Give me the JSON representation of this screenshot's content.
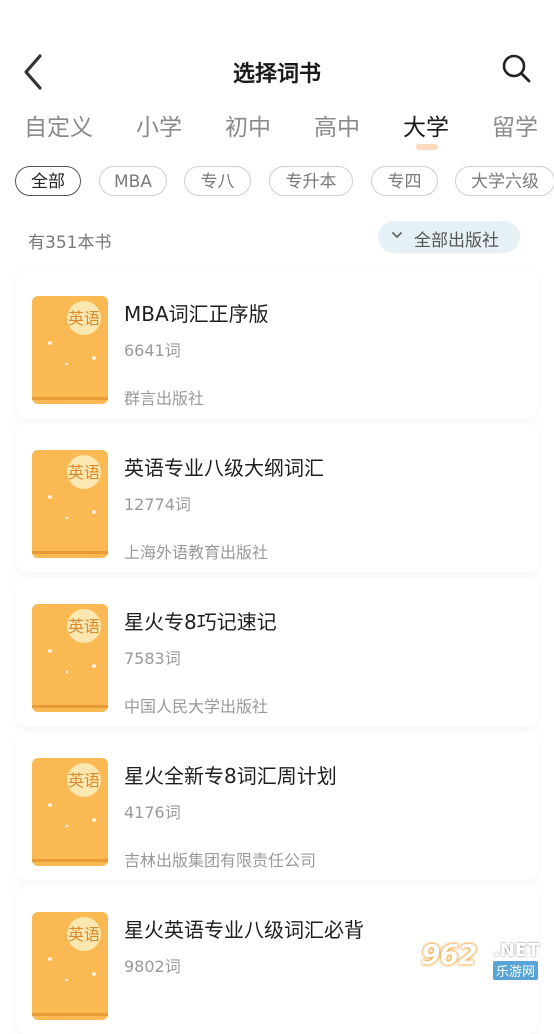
{
  "header": {
    "title": "选择词书",
    "back_icon": "chevron-left-icon",
    "search_icon": "search-icon"
  },
  "tabs": [
    {
      "label": "自定义",
      "active": false
    },
    {
      "label": "小学",
      "active": false
    },
    {
      "label": "初中",
      "active": false
    },
    {
      "label": "高中",
      "active": false
    },
    {
      "label": "大学",
      "active": true
    },
    {
      "label": "留学",
      "active": false
    }
  ],
  "chips": [
    {
      "label": "全部",
      "active": true
    },
    {
      "label": "MBA",
      "active": false
    },
    {
      "label": "专八",
      "active": false
    },
    {
      "label": "专升本",
      "active": false
    },
    {
      "label": "专四",
      "active": false
    },
    {
      "label": "大学六级",
      "active": false
    }
  ],
  "summary": {
    "count_text": "有351本书",
    "publisher_filter": "全部出版社"
  },
  "cover_label": "英语",
  "books": [
    {
      "title": "MBA词汇正序版",
      "words": "6641词",
      "publisher": "群言出版社"
    },
    {
      "title": "英语专业八级大纲词汇",
      "words": "12774词",
      "publisher": "上海外语教育出版社"
    },
    {
      "title": "星火专8巧记速记",
      "words": "7583词",
      "publisher": "中国人民大学出版社"
    },
    {
      "title": "星火全新专8词汇周计划",
      "words": "4176词",
      "publisher": "吉林出版集团有限责任公司"
    },
    {
      "title": "星火英语专业八级词汇必背",
      "words": "9802词",
      "publisher": ""
    }
  ],
  "watermark": {
    "main": "962",
    "suffix": ".NET",
    "sub": "乐游网"
  },
  "colors": {
    "cover_orange": "#fbb954",
    "cover_circle": "#fde7b0",
    "active_tab_indicator": "#ffd9bd",
    "publisher_filter_bg": "#e6f1f6"
  }
}
